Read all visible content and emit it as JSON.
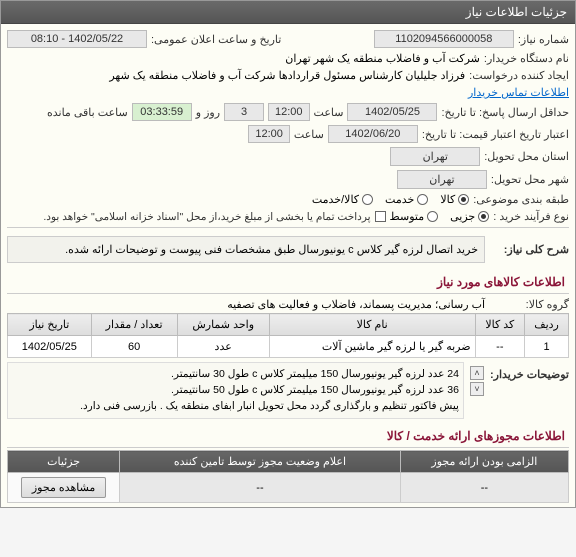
{
  "panel_title": "جزئیات اطلاعات نیاز",
  "need_number": {
    "label": "شماره نیاز:",
    "value": "1102094566000058"
  },
  "announce": {
    "label": "تاریخ و ساعت اعلان عمومی:",
    "value": "1402/05/22 - 08:10"
  },
  "buyer_org": {
    "label": "نام دستگاه خریدار:",
    "value": "شرکت آب و فاضلاب منطقه یک شهر تهران"
  },
  "requester": {
    "label": "ایجاد کننده درخواست:",
    "value": "فرزاد جلیلیان کارشناس مسئول قراردادها شرکت آب و فاضلاب منطقه یک شهر"
  },
  "contact_link": "اطلاعات تماس خریدار",
  "deadline": {
    "label": "حداقل ارسال پاسخ: تا تاریخ:",
    "date": "1402/05/25",
    "time_label": "ساعت",
    "time": "12:00",
    "days": "3",
    "day_label": "روز و",
    "remain": "03:33:59",
    "remain_label": "ساعت باقی مانده"
  },
  "validity": {
    "label": "اعتبار تاریخ اعتبار قیمت: تا تاریخ:",
    "date": "1402/06/20",
    "time_label": "ساعت",
    "time": "12:00"
  },
  "province": {
    "label": "استان محل تحویل:",
    "value": "تهران"
  },
  "city": {
    "label": "شهر محل تحویل:",
    "value": "تهران"
  },
  "category": {
    "label": "طبقه بندی موضوعی:",
    "goods": "کالا",
    "service": "خدمت",
    "goods_service": "کالا/خدمت"
  },
  "process": {
    "label": "نوع فرآیند خرید :",
    "partial": "جزیی",
    "medium": "متوسط",
    "note": "پرداخت تمام یا بخشی از مبلغ خرید،از محل \"اسناد خزانه اسلامی\" خواهد بود."
  },
  "need_desc": {
    "label": "شرح کلی نیاز:",
    "value": "خرید اتصال لرزه گیر کلاس c  یونیورسال طبق مشخصات فنی پیوست و توضیحات ارائه شده."
  },
  "goods_section": "اطلاعات کالاهای مورد نیاز",
  "goods_group": {
    "label": "گروه کالا:",
    "value": "آب رسانی؛ مدیریت پسماند، فاضلاب و فعالیت های تصفیه"
  },
  "table": {
    "headers": [
      "ردیف",
      "کد کالا",
      "نام کالا",
      "واحد شمارش",
      "تعداد / مقدار",
      "تاریخ نیاز"
    ],
    "rows": [
      {
        "idx": "1",
        "code": "--",
        "name": "ضربه گیر یا لرزه گیر ماشین آلات",
        "unit": "عدد",
        "qty": "60",
        "date": "1402/05/25"
      }
    ]
  },
  "buyer_notes": {
    "label": "توضیحات خریدار:",
    "lines": [
      "24 عدد لرزه گیر یونیورسال 150 میلیمتر کلاس c طول 30 سانتیمتر.",
      "36 عدد لرزه گیر یونیورسال 150 میلیمتر کلاس c طول 50 سانتیمتر.",
      "پیش فاکتور تنظیم و بارگذاری گردد محل تحویل انبار ابفای منطقه یک . بازرسی فنی دارد."
    ]
  },
  "license_section": "اطلاعات مجوزهای ارائه خدمت / کالا",
  "license_table": {
    "headers": [
      "الزامی بودن ارائه مجوز",
      "اعلام وضعیت مجوز توسط تامین کننده",
      "جزئیات"
    ],
    "cells": [
      "--",
      "--"
    ],
    "btn": "مشاهده مجوز"
  }
}
